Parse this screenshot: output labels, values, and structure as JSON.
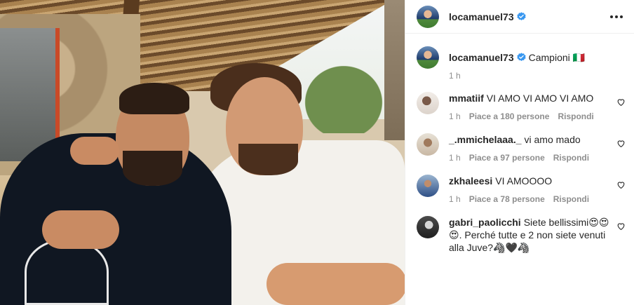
{
  "post": {
    "author": "locamanuel73",
    "caption": "Campioni 🇮🇹",
    "caption_time": "1 h"
  },
  "comments": [
    {
      "username": "mmatiif",
      "text": "VI AMO VI AMO VI AMO",
      "time": "1 h",
      "likes": "Piace a 180 persone",
      "reply": "Rispondi"
    },
    {
      "username": "_.mmichelaaa._",
      "text": "vi amo mado",
      "time": "1 h",
      "likes": "Piace a 97 persone",
      "reply": "Rispondi"
    },
    {
      "username": "zkhaleesi",
      "text": "VI AMOOOO",
      "time": "1 h",
      "likes": "Piace a 78 persone",
      "reply": "Rispondi"
    },
    {
      "username": "gabri_paolicchi",
      "text": "Siete bellissimi😍😍😍. Perché tutte e 2 non siete venuti alla Juve?🦓🖤🦓"
    }
  ],
  "colors": {
    "verified": "#3897f0",
    "text": "#262626",
    "muted": "#8e8e8e",
    "border": "#efefef"
  },
  "icons": {
    "verified": "verified-badge-icon",
    "more": "more-options-icon",
    "like": "heart-icon"
  }
}
